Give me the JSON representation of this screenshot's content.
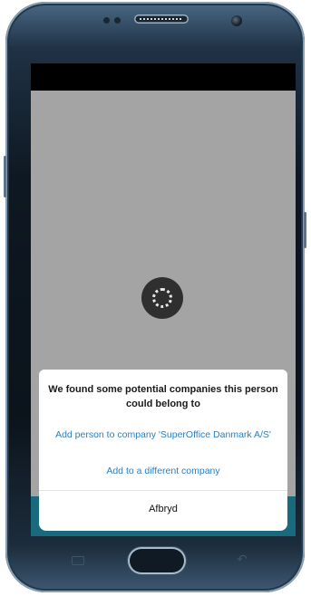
{
  "device": {
    "frame_color": "#0e1822",
    "accent_color": "#8aa0b4"
  },
  "app": {
    "overlay_color": "#a4a4a4",
    "footer_color": "#1a6a7e",
    "loading_icon": "spinner-icon"
  },
  "dialog": {
    "title": "We found some potential companies this person could belong to",
    "option_add_to_company": "Add person to company 'SuperOffice Danmark A/S'",
    "option_different_company": "Add to a different company",
    "cancel_label": "Afbryd",
    "link_color": "#2b7fc1"
  }
}
